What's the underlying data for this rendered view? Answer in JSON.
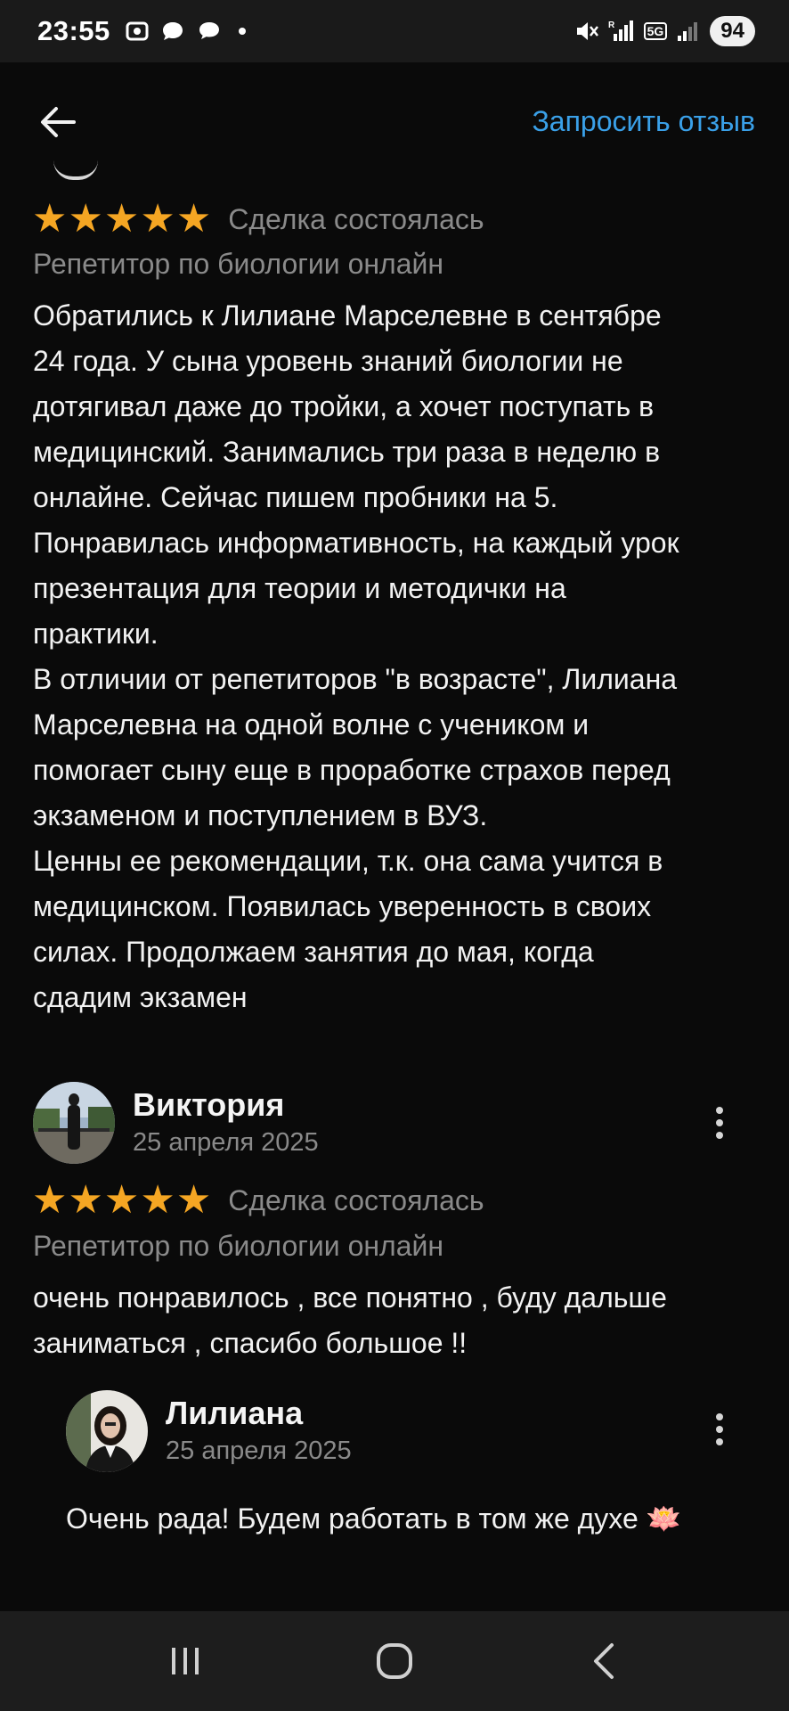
{
  "status_bar": {
    "time": "23:55",
    "network": "5G",
    "battery": "94"
  },
  "header": {
    "request_review_label": "Запросить отзыв"
  },
  "reviews": [
    {
      "rating": 5,
      "deal_status": "Сделка состоялась",
      "category": "Репетитор по биологии онлайн",
      "text_lines": [
        "Обратились к Лилиане Марселевне в сентябре",
        "24 года. У сына уровень знаний биологии не",
        "дотягивал даже до тройки, а хочет поступать в",
        "медицинский. Занимались три раза в неделю в",
        "онлайне. Сейчас пишем пробники на 5.",
        "Понравилась информативность, на каждый урок",
        "презентация для теории и методички на",
        "практики.",
        "В отличии от репетиторов \"в возрасте\", Лилиана",
        "Марселевна на одной волне с учеником и",
        "помогает сыну еще в проработке страхов перед",
        "экзаменом и поступлением в ВУЗ.",
        "Ценны ее рекомендации, т.к. она сама учится в",
        "медицинском. Появилась уверенность в своих",
        "силах. Продолжаем занятия до мая, когда",
        "сдадим экзамен"
      ]
    },
    {
      "author": "Виктория",
      "date": "25 апреля 2025",
      "rating": 5,
      "deal_status": "Сделка состоялась",
      "category": "Репетитор по биологии онлайн",
      "text_lines": [
        "очень понравилось , все понятно , буду дальше",
        "заниматься , спасибо большое !!"
      ],
      "reply": {
        "author": "Лилиана",
        "date": "25 апреля 2025",
        "text": "Очень рада! Будем работать в том же духе 🪷"
      }
    }
  ],
  "icons": {
    "back": "arrow-left-icon",
    "more": "more-vertical-icon",
    "star": "star-icon",
    "nav_recents": "recents-icon",
    "nav_home": "home-icon",
    "nav_back": "chevron-left-icon"
  },
  "colors": {
    "background": "#0a0a0a",
    "accent": "#3aa0e8",
    "star": "#f5a623",
    "muted_text": "#8a8a8a"
  }
}
